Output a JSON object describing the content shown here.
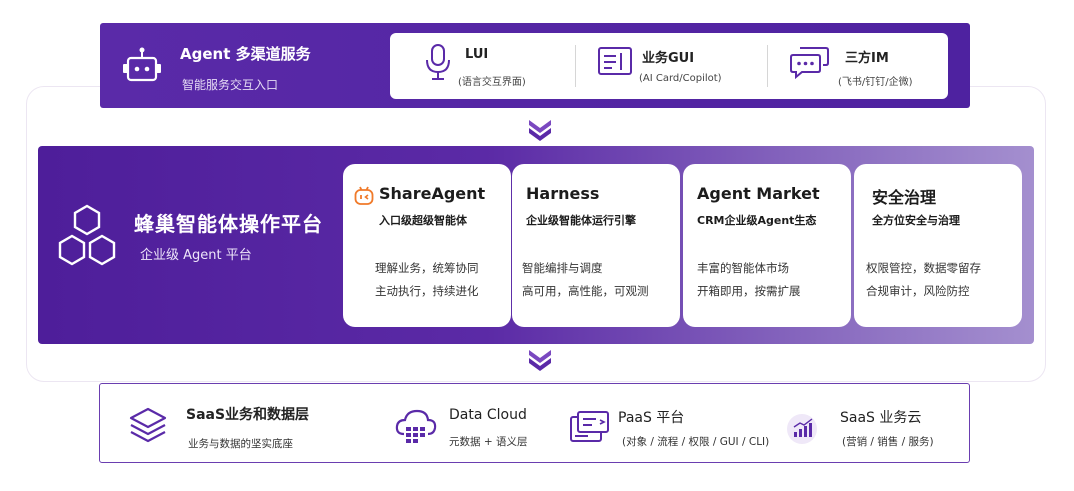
{
  "channel": {
    "title": "Agent 多渠道服务",
    "subtitle": "智能服务交互入口",
    "items": [
      {
        "title": "LUI",
        "sub": "(语言交互界面)"
      },
      {
        "title": "业务GUI",
        "sub": "(AI Card/Copilot)"
      },
      {
        "title": "三方IM",
        "sub": "(飞书/钉钉/企微)"
      }
    ]
  },
  "platform": {
    "title": "蜂巢智能体操作平台",
    "subtitle": "企业级 Agent 平台",
    "cards": [
      {
        "title": "ShareAgent",
        "sub": "入口级超级智能体",
        "lines": [
          "理解业务，统筹协同",
          "主动执行，持续进化"
        ]
      },
      {
        "title": "Harness",
        "sub": "企业级智能体运行引擎",
        "lines": [
          "智能编排与调度",
          "高可用，高性能，可观测"
        ]
      },
      {
        "title": "Agent Market",
        "sub": "CRM企业级Agent生态",
        "lines": [
          "丰富的智能体市场",
          "开箱即用，按需扩展"
        ]
      },
      {
        "title": "安全治理",
        "sub": "全方位安全与治理",
        "lines": [
          "权限管控，数据零留存",
          "合规审计，风险防控"
        ]
      }
    ]
  },
  "saas": {
    "title": "SaaS业务和数据层",
    "subtitle": "业务与数据的坚实底座",
    "items": [
      {
        "title": "Data Cloud",
        "sub": "元数据 + 语义层"
      },
      {
        "title": "PaaS 平台",
        "sub": "(对象 / 流程 / 权限 / GUI / CLI)"
      },
      {
        "title": "SaaS 业务云",
        "sub": "(营销 / 销售 / 服务)"
      }
    ]
  },
  "colors": {
    "brand_purple": "#5a2aa8",
    "accent_orange": "#f07a2a",
    "arrow": "#6a36b8"
  },
  "icons": [
    "robot-icon",
    "microphone-icon",
    "gui-window-icon",
    "chat-bubbles-icon",
    "hexagon-cluster-icon",
    "share-agent-face-icon",
    "stack-layers-icon",
    "cloud-database-icon",
    "paas-terminal-icon",
    "bar-chart-icon",
    "chevron-down-icon"
  ]
}
